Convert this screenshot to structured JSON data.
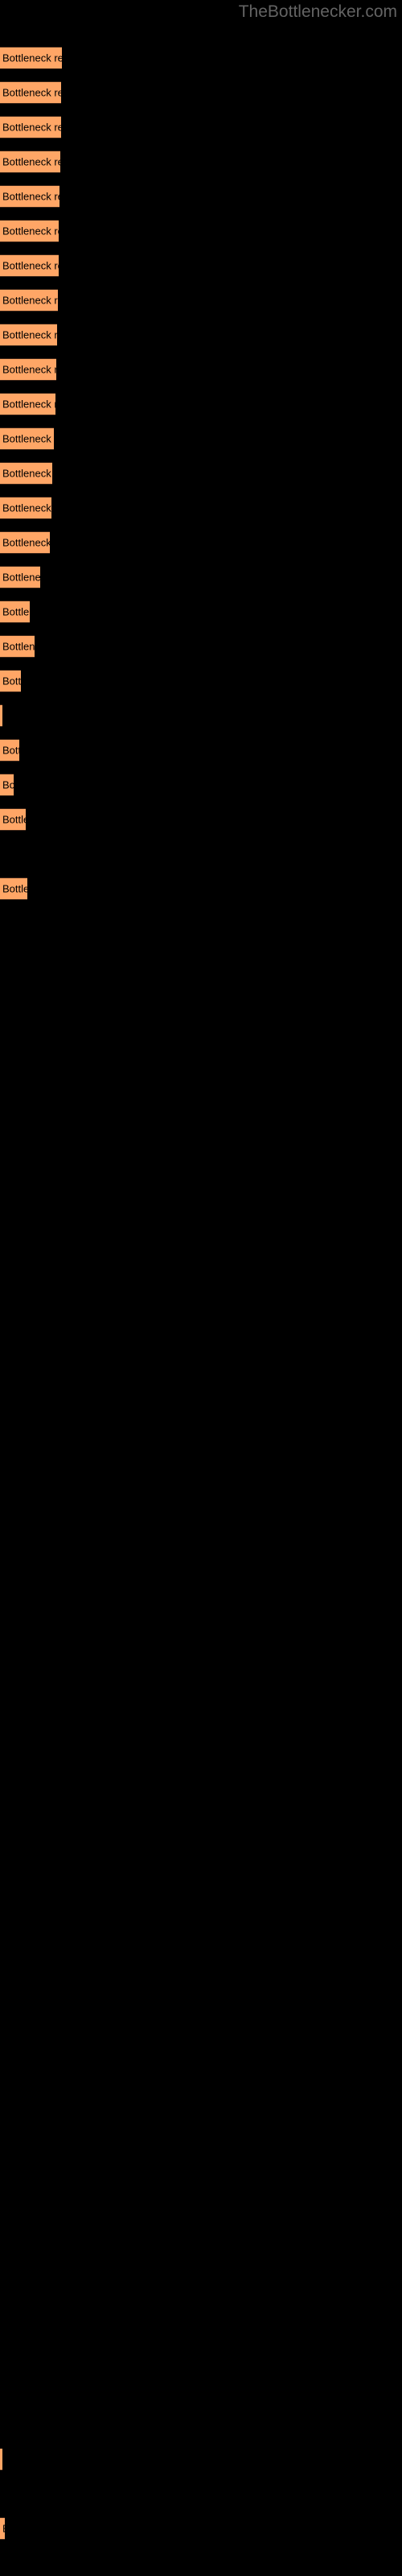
{
  "watermark": "TheBottlenecker.com",
  "colors": {
    "background": "#000000",
    "bar_fill": "#ffa666",
    "bar_edge": "#3a2416",
    "bar_label": "#000000",
    "watermark": "#636363"
  },
  "chart_data": {
    "type": "bar",
    "orientation": "horizontal",
    "title": "",
    "subtitle": "",
    "xlabel": "",
    "ylabel": "",
    "grid": false,
    "legend": null,
    "axis_visible": false,
    "tick_labels_visible": false,
    "bar_label_text": "Bottleneck result",
    "xlim": [
      0,
      500
    ],
    "categories": [
      "bar-1",
      "bar-2",
      "bar-3",
      "bar-4",
      "bar-5",
      "bar-6",
      "bar-7",
      "bar-8",
      "bar-9",
      "bar-10",
      "bar-11",
      "bar-12",
      "bar-13",
      "bar-14",
      "bar-15",
      "bar-16",
      "bar-17",
      "bar-18",
      "bar-19",
      "bar-20",
      "bar-21",
      "bar-22",
      "bar-23",
      "bar-24",
      "bar-25",
      "bar-26"
    ],
    "values": [
      77,
      76,
      76,
      75,
      74,
      73,
      73,
      72,
      71,
      70,
      69,
      67,
      65,
      64,
      62,
      50,
      37,
      43,
      26,
      3,
      24,
      17,
      32,
      34,
      3,
      6
    ],
    "bars": [
      {
        "name": "bar-1",
        "y": 58,
        "width": 77,
        "label": "Bottleneck result"
      },
      {
        "name": "bar-2",
        "y": 101,
        "width": 76,
        "label": "Bottleneck result"
      },
      {
        "name": "bar-3",
        "y": 144,
        "width": 76,
        "label": "Bottleneck result"
      },
      {
        "name": "bar-4",
        "y": 187,
        "width": 75,
        "label": "Bottleneck result"
      },
      {
        "name": "bar-5",
        "y": 230,
        "width": 74,
        "label": "Bottleneck result"
      },
      {
        "name": "bar-6",
        "y": 273,
        "width": 73,
        "label": "Bottleneck result"
      },
      {
        "name": "bar-7",
        "y": 316,
        "width": 73,
        "label": "Bottleneck result"
      },
      {
        "name": "bar-8",
        "y": 359,
        "width": 72,
        "label": "Bottleneck result"
      },
      {
        "name": "bar-9",
        "y": 402,
        "width": 71,
        "label": "Bottleneck result"
      },
      {
        "name": "bar-10",
        "y": 445,
        "width": 70,
        "label": "Bottleneck result"
      },
      {
        "name": "bar-11",
        "y": 488,
        "width": 69,
        "label": "Bottleneck result"
      },
      {
        "name": "bar-12",
        "y": 531,
        "width": 67,
        "label": "Bottleneck result"
      },
      {
        "name": "bar-13",
        "y": 574,
        "width": 65,
        "label": "Bottleneck result"
      },
      {
        "name": "bar-14",
        "y": 617,
        "width": 64,
        "label": "Bottleneck result"
      },
      {
        "name": "bar-15",
        "y": 660,
        "width": 62,
        "label": "Bottleneck result"
      },
      {
        "name": "bar-16",
        "y": 703,
        "width": 50,
        "label": "Bottleneck result"
      },
      {
        "name": "bar-17",
        "y": 746,
        "width": 37,
        "label": "Bottleneck result"
      },
      {
        "name": "bar-18",
        "y": 789,
        "width": 43,
        "label": "Bottleneck result"
      },
      {
        "name": "bar-19",
        "y": 832,
        "width": 26,
        "label": "Bottleneck result"
      },
      {
        "name": "bar-20",
        "y": 875,
        "width": 3,
        "label": "Bottleneck result"
      },
      {
        "name": "bar-21",
        "y": 918,
        "width": 24,
        "label": "Bottleneck result"
      },
      {
        "name": "bar-22",
        "y": 961,
        "width": 17,
        "label": "Bottleneck result"
      },
      {
        "name": "bar-23",
        "y": 1004,
        "width": 32,
        "label": "Bottleneck result"
      },
      {
        "name": "bar-24",
        "y": 1090,
        "width": 34,
        "label": "Bottleneck result"
      },
      {
        "name": "bar-25",
        "y": 3041,
        "width": 3,
        "label": "Bottleneck result"
      },
      {
        "name": "bar-26",
        "y": 3127,
        "width": 6,
        "label": "Bottleneck result"
      }
    ]
  }
}
